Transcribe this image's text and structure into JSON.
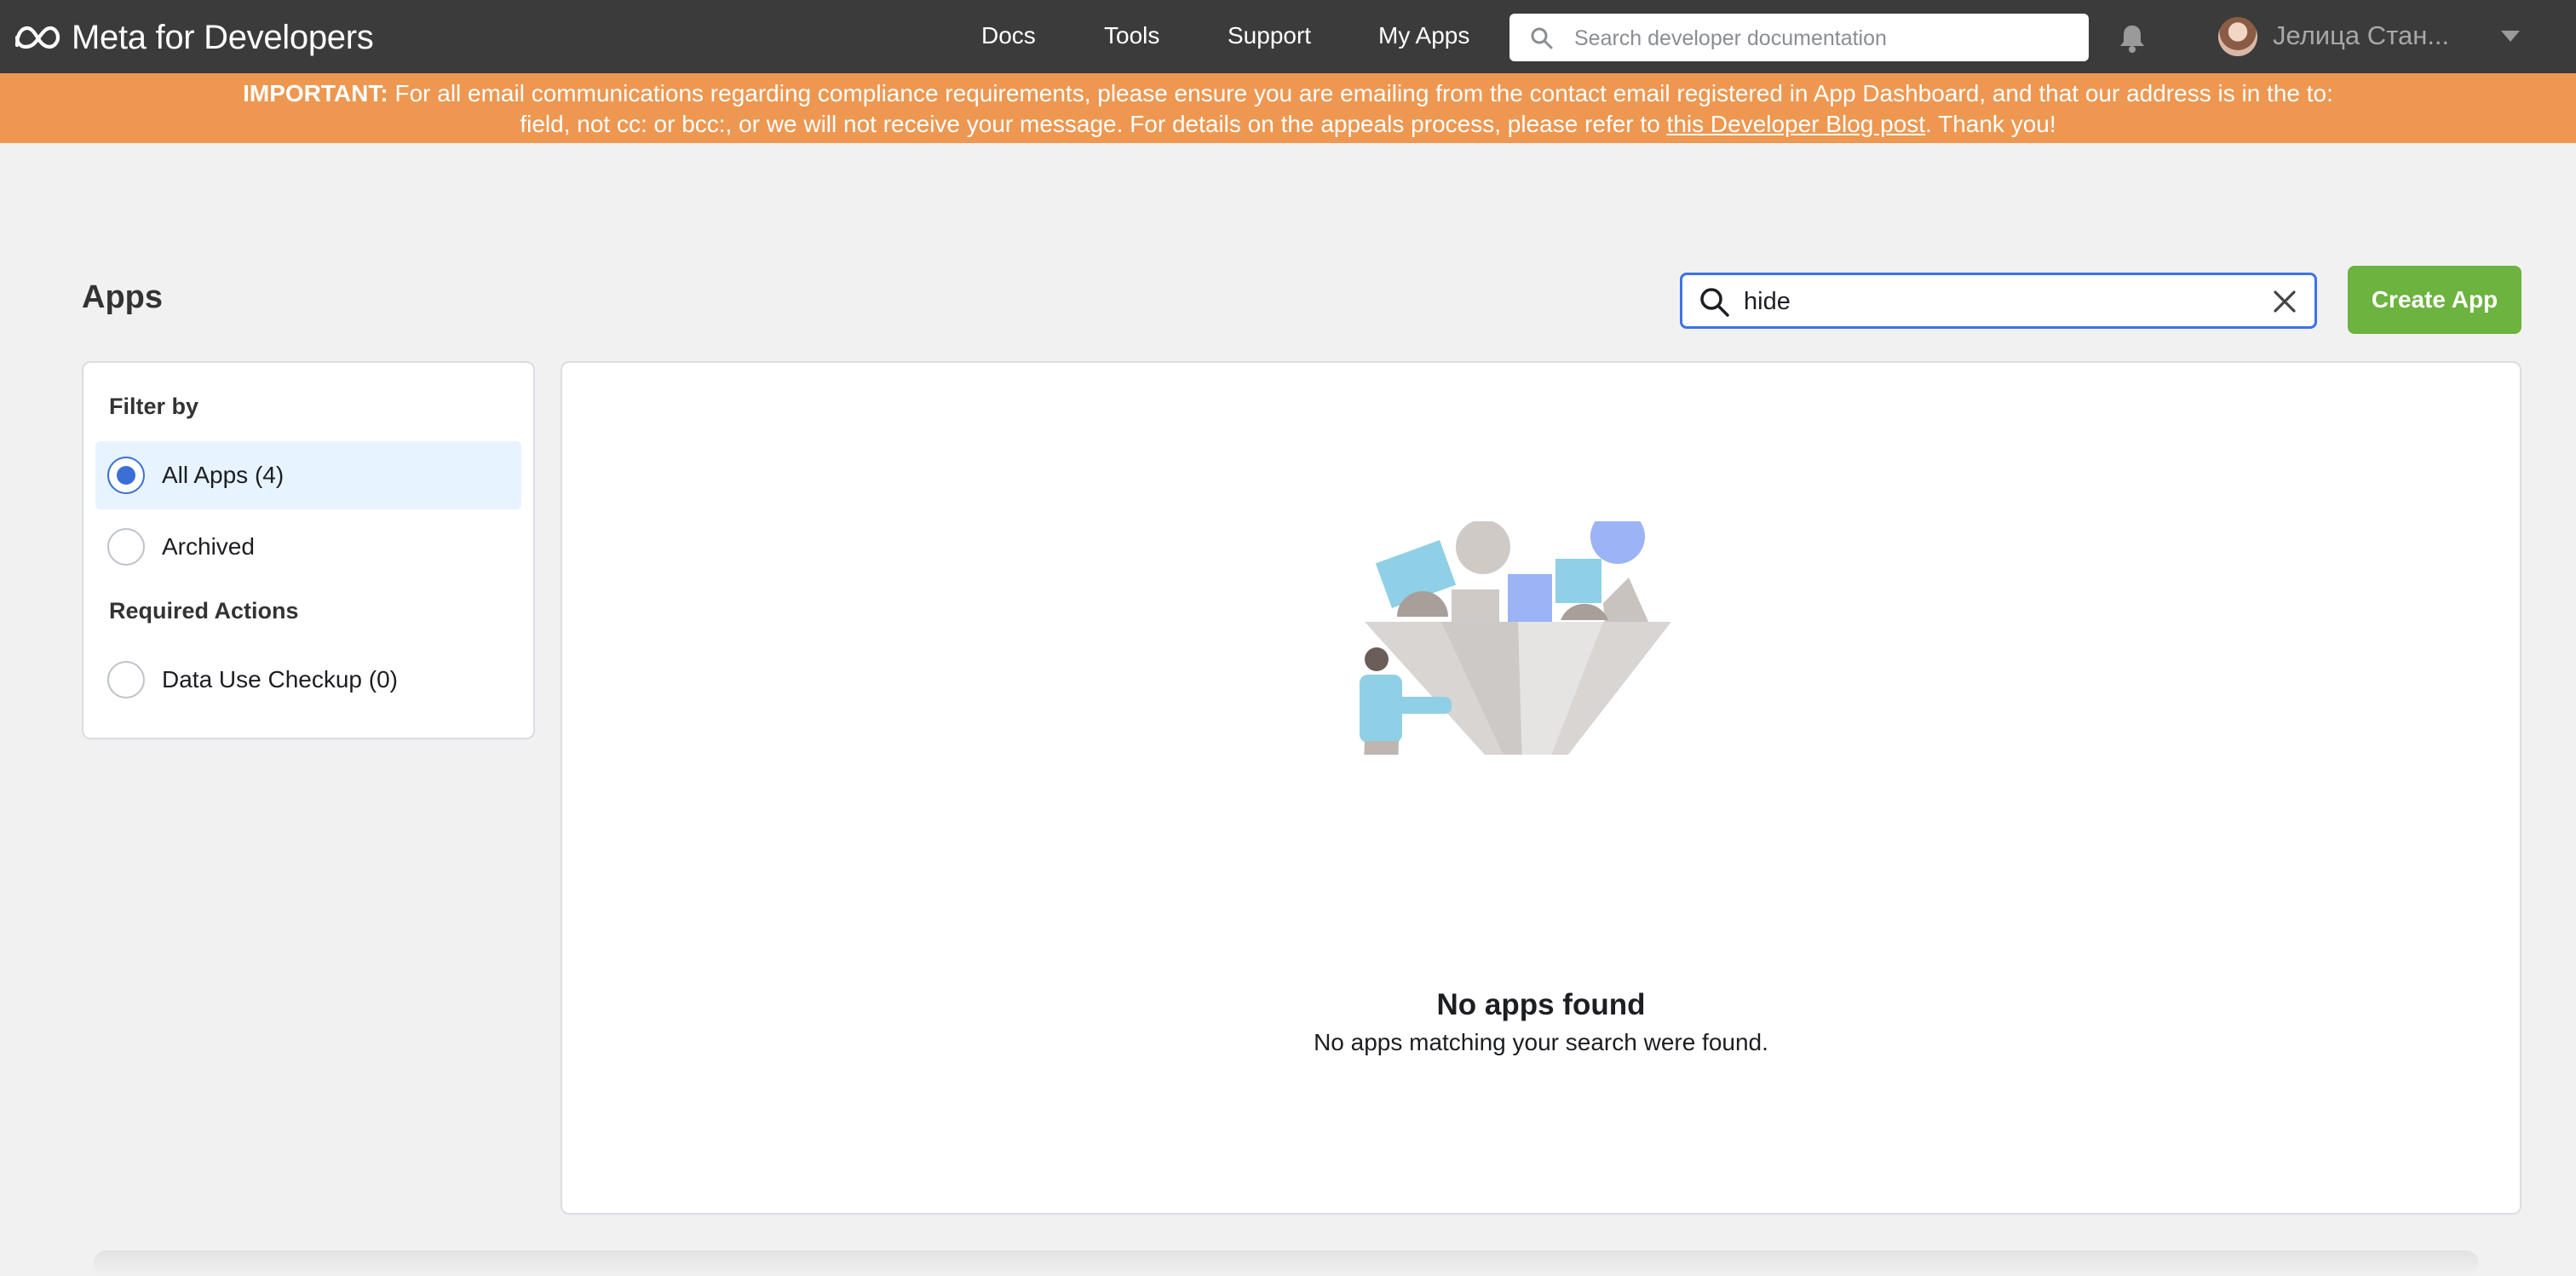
{
  "nav": {
    "logo_text": "Meta for Developers",
    "links": [
      "Docs",
      "Tools",
      "Support",
      "My Apps"
    ],
    "search_placeholder": "Search developer documentation",
    "username": "Јелица Стан..."
  },
  "banner": {
    "important": "IMPORTANT:",
    "text_line1": " For all email communications regarding compliance requirements, please ensure you are emailing from the contact email registered in App Dashboard, and that our address is in the to:",
    "text_line2_pre": "field, not cc: or bcc:, or we will not receive your message. For details on the appeals process, please refer to ",
    "link_text": "this Developer Blog post",
    "text_line2_post": ". Thank you!"
  },
  "apps": {
    "title": "Apps",
    "search_value": "hide",
    "create_label": "Create App"
  },
  "filter": {
    "heading": "Filter by",
    "options": [
      {
        "label": "All Apps (4)",
        "checked": true
      },
      {
        "label": "Archived",
        "checked": false
      }
    ],
    "required_heading": "Required Actions",
    "required_options": [
      {
        "label": "Data Use Checkup (0)",
        "checked": false
      }
    ]
  },
  "empty_state": {
    "title": "No apps found",
    "subtitle": "No apps matching your search were found."
  },
  "colors": {
    "topbar": "#3b3b3b",
    "banner": "#ee9751",
    "accent_blue": "#3b6fd6",
    "create_green": "#6db33f"
  },
  "icons": [
    "meta-logo-icon",
    "search-icon",
    "bell-icon",
    "chevron-down-icon",
    "clear-icon",
    "empty-state-illustration"
  ]
}
